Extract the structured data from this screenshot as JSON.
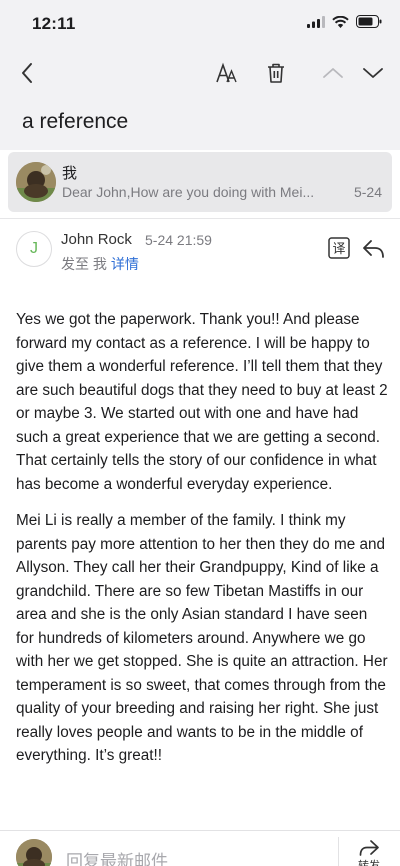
{
  "status_bar": {
    "time": "12:11"
  },
  "toolbar": {
    "back_icon": "chevron-left-icon",
    "font_icon": "text-size-icon",
    "delete_icon": "trash-icon",
    "prev_icon": "chevron-up-icon",
    "next_icon": "chevron-down-icon"
  },
  "subject": "a reference",
  "thread": {
    "name": "我",
    "preview": "Dear John,How are you doing with Mei...",
    "date": "5-24"
  },
  "message": {
    "avatar_letter": "J",
    "sender": "John Rock",
    "time": "5-24 21:59",
    "sent_to": "发至 我",
    "details_link": "详情",
    "paragraphs": [
      "Yes we got the paperwork. Thank you!!   And please forward my contact as a reference.  I will be happy to give them a wonderful reference.  I’ll tell them that they are such beautiful dogs that they need to buy at least 2 or maybe 3.   We started out with one and have had such a great experience that we are getting a second.  That certainly tells the story of our confidence in what has become a wonderful everyday experience.",
      "Mei Li is really a member of the family.   I think my parents pay more attention to her then they do me and Allyson.  They call her their Grandpuppy, Kind of like a grandchild.  There are so few Tibetan Mastiffs in our area and she is the only Asian standard I have seen for hundreds of kilometers around.   Anywhere we go with her we get stopped.  She is quite an attraction.   Her temperament is so sweet, that comes through from the quality of your breeding and raising her right.  She just really loves people and wants to be in the middle of everything.  It’s great!!"
    ]
  },
  "footer": {
    "reply_placeholder": "回复最新邮件",
    "forward_label": "转发"
  },
  "colors": {
    "accent": "#2f6fd6",
    "avatar_letter": "#67b85a",
    "header_bg": "#f2f2f4"
  }
}
